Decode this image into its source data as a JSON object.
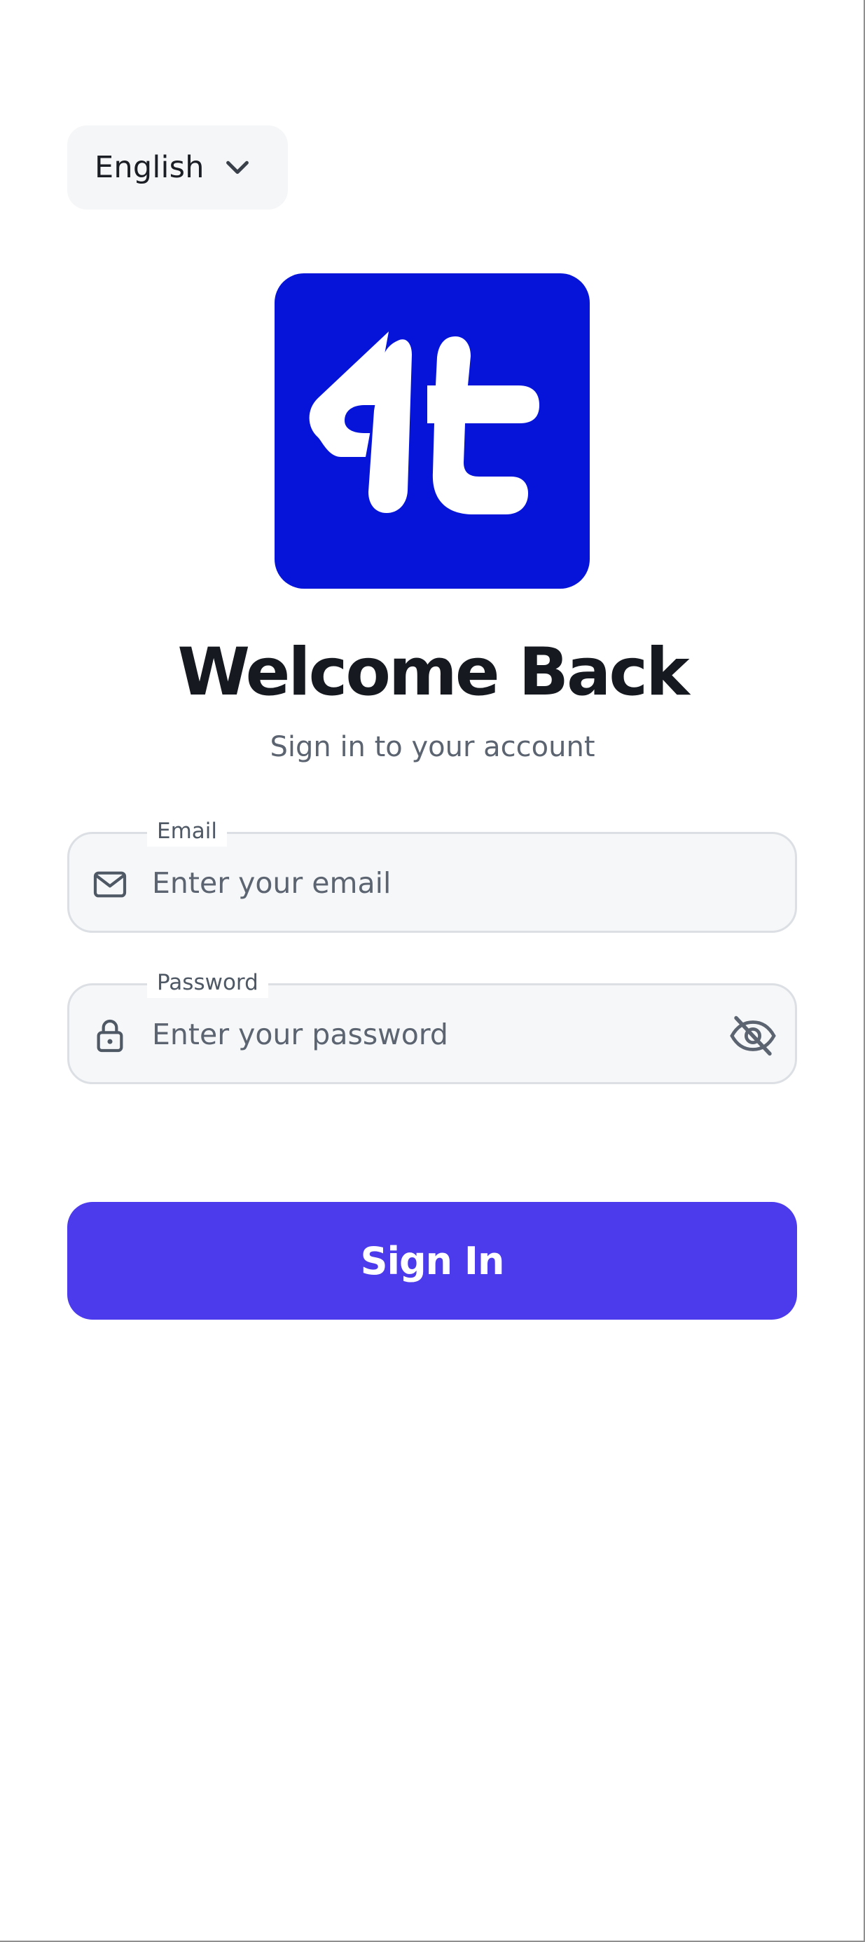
{
  "language_selector": {
    "selected": "English",
    "icon": "chevron-down-icon"
  },
  "logo": {
    "icon": "app-logo-4t",
    "background_color": "#0614d9"
  },
  "header": {
    "title": "Welcome Back",
    "subtitle": "Sign in to your account"
  },
  "form": {
    "email": {
      "label": "Email",
      "placeholder": "Enter your email",
      "value": "",
      "icon": "mail-icon"
    },
    "password": {
      "label": "Password",
      "placeholder": "Enter your password",
      "value": "",
      "icon": "lock-icon",
      "toggle_icon": "eye-off-icon"
    },
    "submit_label": "Sign In"
  },
  "colors": {
    "primary": "#4b3bed",
    "field_bg": "#f6f7f8",
    "field_border": "#dcdfe4",
    "text_muted": "#5b6470"
  }
}
